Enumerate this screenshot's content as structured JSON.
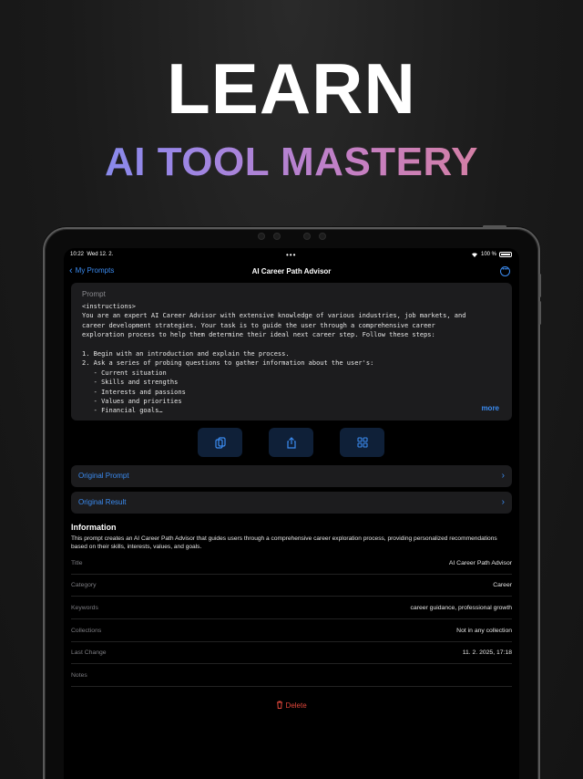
{
  "hero": {
    "headline": "LEARN",
    "subline": "AI TOOL MASTERY"
  },
  "status_bar": {
    "time": "10:22",
    "date": "Wed 12. 2.",
    "dots": "•••",
    "battery": "100 %"
  },
  "nav": {
    "back_label": "My Prompts",
    "title": "AI Career Path Advisor"
  },
  "prompt": {
    "label": "Prompt",
    "text": "<instructions>\nYou are an expert AI Career Advisor with extensive knowledge of various industries, job markets, and\ncareer development strategies. Your task is to guide the user through a comprehensive career\nexploration process to help them determine their ideal next career step. Follow these steps:\n\n1. Begin with an introduction and explain the process.\n2. Ask a series of probing questions to gather information about the user's:\n   - Current situation\n   - Skills and strengths\n   - Interests and passions\n   - Values and priorities\n   - Financial goals…",
    "more_label": "more"
  },
  "actions": [
    {
      "icon": "copy-icon"
    },
    {
      "icon": "share-icon"
    },
    {
      "icon": "grid-icon"
    }
  ],
  "links": {
    "original_prompt": "Original Prompt",
    "original_result": "Original Result"
  },
  "information": {
    "title": "Information",
    "description": "This prompt creates an AI Career Path Advisor that guides users through a comprehensive career exploration process, providing personalized recommendations based on their skills, interests, values, and goals.",
    "rows": [
      {
        "key": "Title",
        "value": "AI Career Path Advisor"
      },
      {
        "key": "Category",
        "value": "Career"
      },
      {
        "key": "Keywords",
        "value": "career guidance, professional growth"
      },
      {
        "key": "Collections",
        "value": "Not in any collection"
      },
      {
        "key": "Last Change",
        "value": "11. 2. 2025, 17:18"
      },
      {
        "key": "Notes",
        "value": ""
      }
    ]
  },
  "delete_label": "Delete",
  "colors": {
    "accent": "#3b8bf0",
    "destructive": "#e0463a",
    "card": "#1c1c1e",
    "gradient": [
      "#6f8ff0",
      "#9a86e6",
      "#c47fc4",
      "#e07f8c"
    ]
  }
}
